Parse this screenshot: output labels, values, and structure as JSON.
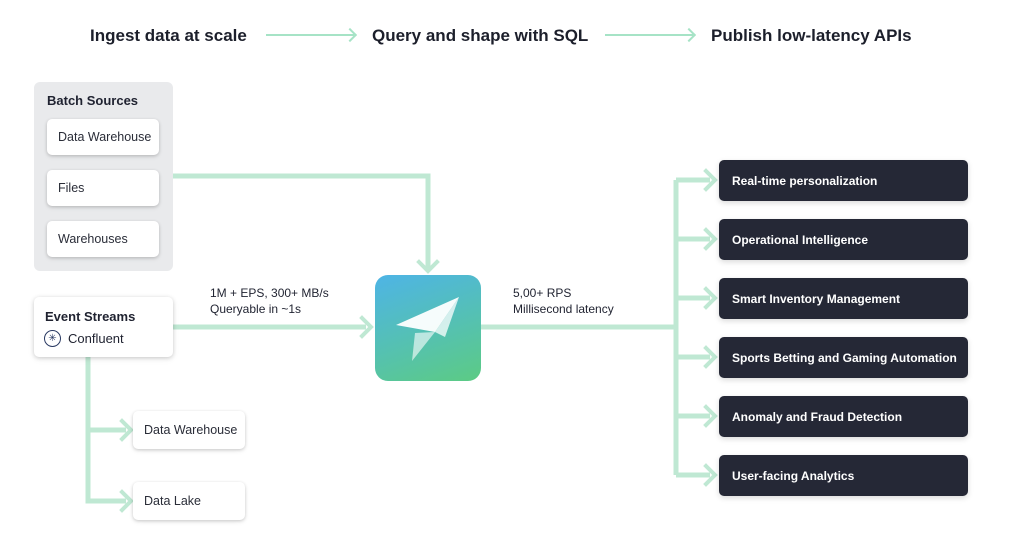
{
  "stages": [
    {
      "label": "Ingest data at scale"
    },
    {
      "label": "Query and shape with SQL"
    },
    {
      "label": "Publish low-latency APIs"
    }
  ],
  "batch_sources": {
    "title": "Batch Sources",
    "items": [
      "Data Warehouse",
      "Files",
      "Warehouses"
    ]
  },
  "event_streams": {
    "title": "Event Streams",
    "provider": "Confluent",
    "provider_icon": "confluent-icon"
  },
  "sinks": [
    "Data Warehouse",
    "Data Lake"
  ],
  "ingest_metrics": {
    "line1": "1M + EPS, 300+ MB/s",
    "line2": "Queryable in ~1s"
  },
  "api_metrics": {
    "line1": "5,00+ RPS",
    "line2": "Millisecond latency"
  },
  "center_logo": {
    "icon": "paper-plane-bird-logo"
  },
  "use_cases": [
    "Real-time personalization",
    "Operational Intelligence",
    "Smart Inventory Management",
    "Sports Betting and Gaming Automation",
    "Anomaly and Fraud Detection",
    "User-facing Analytics"
  ],
  "colors": {
    "connector": "#bfe8d3",
    "use_case_bg": "#252836",
    "batch_group_bg": "#e9eaec",
    "logo_gradient_start": "#4eb4e6",
    "logo_gradient_end": "#5ccb84"
  }
}
